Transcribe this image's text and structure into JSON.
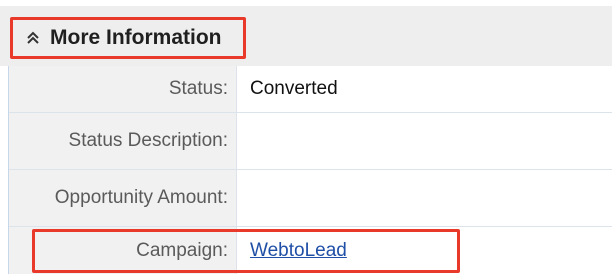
{
  "section": {
    "title": "More Information",
    "icon": "double-chevron-up-icon",
    "highlight_color": "#e8392b"
  },
  "fields": [
    {
      "label": "Status:",
      "value": "Converted"
    },
    {
      "label": "Status Description:",
      "value": ""
    },
    {
      "label": "Opportunity Amount:",
      "value": ""
    },
    {
      "label": "Campaign:",
      "value": "WebtoLead",
      "link": true
    }
  ]
}
